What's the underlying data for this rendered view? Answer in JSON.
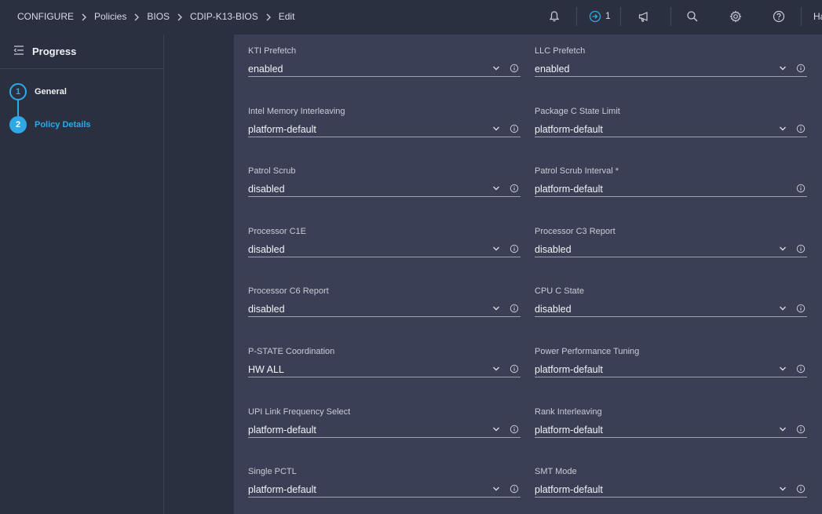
{
  "breadcrumb": [
    "CONFIGURE",
    "Policies",
    "BIOS",
    "CDIP-K13-BIOS",
    "Edit"
  ],
  "topbar": {
    "requests_count": "1",
    "user_initial_truncated": "Ha"
  },
  "progress": {
    "title": "Progress",
    "steps": [
      {
        "num": "1",
        "label": "General",
        "state": "completed"
      },
      {
        "num": "2",
        "label": "Policy Details",
        "state": "active"
      }
    ]
  },
  "fields": [
    {
      "label": "KTI Prefetch",
      "value": "enabled",
      "type": "select"
    },
    {
      "label": "LLC Prefetch",
      "value": "enabled",
      "type": "select"
    },
    {
      "label": "Intel Memory Interleaving",
      "value": "platform-default",
      "type": "select"
    },
    {
      "label": "Package C State Limit",
      "value": "platform-default",
      "type": "select"
    },
    {
      "label": "Patrol Scrub",
      "value": "disabled",
      "type": "select"
    },
    {
      "label": "Patrol Scrub Interval *",
      "value": "platform-default",
      "type": "input"
    },
    {
      "label": "Processor C1E",
      "value": "disabled",
      "type": "select"
    },
    {
      "label": "Processor C3 Report",
      "value": "disabled",
      "type": "select"
    },
    {
      "label": "Processor C6 Report",
      "value": "disabled",
      "type": "select"
    },
    {
      "label": "CPU C State",
      "value": "disabled",
      "type": "select"
    },
    {
      "label": "P-STATE Coordination",
      "value": "HW ALL",
      "type": "select"
    },
    {
      "label": "Power Performance Tuning",
      "value": "platform-default",
      "type": "select"
    },
    {
      "label": "UPI Link Frequency Select",
      "value": "platform-default",
      "type": "select"
    },
    {
      "label": "Rank Interleaving",
      "value": "platform-default",
      "type": "select"
    },
    {
      "label": "Single PCTL",
      "value": "platform-default",
      "type": "select"
    },
    {
      "label": "SMT Mode",
      "value": "platform-default",
      "type": "select"
    }
  ],
  "colors": {
    "accent": "#2ea8e6",
    "panel_bg": "#2b3040",
    "main_bg": "#3a3f55"
  },
  "icons": [
    "bell-icon",
    "requests-icon",
    "megaphone-icon",
    "search-icon",
    "gear-icon",
    "help-icon",
    "collapse-menu-icon",
    "chevron-down-icon",
    "info-icon"
  ]
}
